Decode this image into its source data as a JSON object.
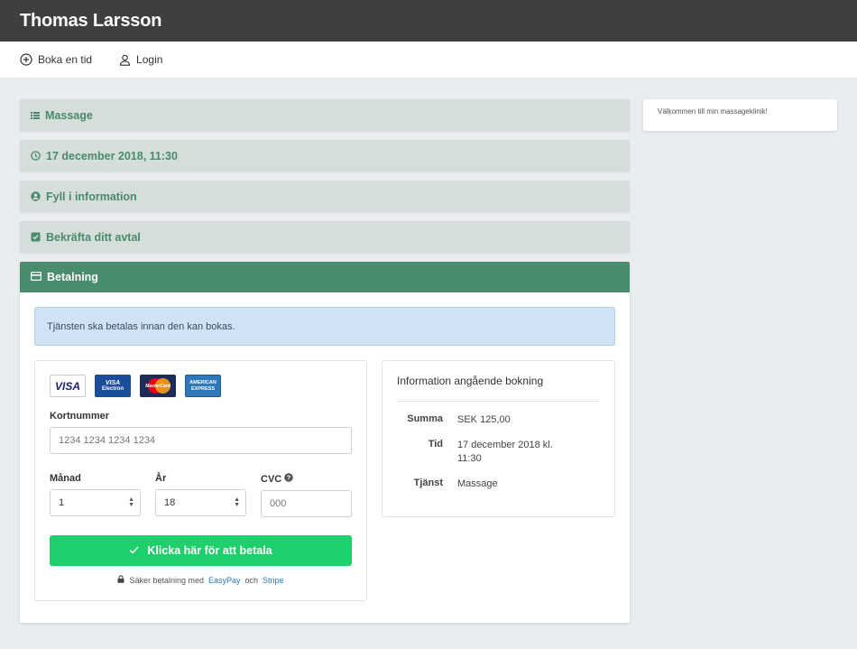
{
  "header": {
    "title": "Thomas Larsson"
  },
  "nav": {
    "book_label": "Boka en tid",
    "login_label": "Login"
  },
  "steps": [
    {
      "label": "Massage",
      "icon": "list-icon"
    },
    {
      "label": "17 december 2018, 11:30",
      "icon": "clock-icon"
    },
    {
      "label": "Fyll i information",
      "icon": "user-circle-icon"
    },
    {
      "label": "Bekräfta ditt avtal",
      "icon": "check-square-icon"
    }
  ],
  "payment": {
    "header": "Betalning",
    "alert": "Tjänsten ska betalas innan den kan bokas.",
    "card_logos": {
      "visa": "VISA",
      "electron_top": "VISA",
      "electron_bottom": "Electron",
      "mastercard": "MasterCard",
      "amex_top": "AMERICAN",
      "amex_bottom": "EXPRESS"
    },
    "card_number_label": "Kortnummer",
    "card_number_placeholder": "1234 1234 1234 1234",
    "month_label": "Månad",
    "month_value": "1",
    "year_label": "År",
    "year_value": "18",
    "cvc_label": "CVC",
    "cvc_placeholder": "000",
    "pay_button": "Klicka här för att betala",
    "secure_prefix": "Säker betalning med",
    "secure_easypay": "EasyPay",
    "secure_and": "och",
    "secure_stripe": "Stripe"
  },
  "booking_info": {
    "title": "Information angående bokning",
    "sum_label": "Summa",
    "sum_value": "SEK 125,00",
    "time_label": "Tid",
    "time_value": "17 december 2018 kl. 11:30",
    "service_label": "Tjänst",
    "service_value": "Massage"
  },
  "sidebar": {
    "welcome": "Välkommen till min massageklinik!"
  },
  "colors": {
    "accent": "#4a8c6e",
    "pay_button": "#1fcf6b",
    "topbar": "#3f3f3f",
    "step_bg": "#d5dedb"
  }
}
